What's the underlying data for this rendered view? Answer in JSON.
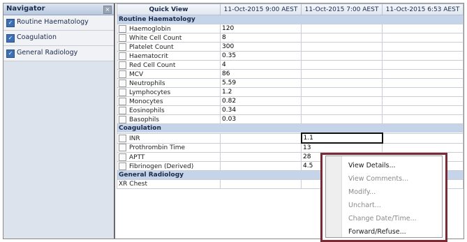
{
  "navigator": {
    "title": "Navigator",
    "close_glyph": "×",
    "items": [
      {
        "label": "Routine Haematology",
        "checked": true
      },
      {
        "label": "Coagulation",
        "checked": true
      },
      {
        "label": "General Radiology",
        "checked": true
      }
    ]
  },
  "grid": {
    "headers": [
      "Quick View",
      "11-Oct-2015 9:00 AEST",
      "11-Oct-2015 7:00 AEST",
      "11-Oct-2015 6:53 AEST"
    ],
    "sections": [
      {
        "title": "Routine Haematology",
        "rows": [
          {
            "name": "Haemoglobin",
            "checkbox": true,
            "values": [
              "120",
              "",
              ""
            ]
          },
          {
            "name": "White Cell Count",
            "checkbox": true,
            "values": [
              "8",
              "",
              ""
            ]
          },
          {
            "name": "Platelet Count",
            "checkbox": true,
            "values": [
              "300",
              "",
              ""
            ]
          },
          {
            "name": "Haematocrit",
            "checkbox": true,
            "values": [
              "0.35",
              "",
              ""
            ]
          },
          {
            "name": "Red Cell Count",
            "checkbox": true,
            "values": [
              "4",
              "",
              ""
            ]
          },
          {
            "name": "MCV",
            "checkbox": true,
            "values": [
              "86",
              "",
              ""
            ]
          },
          {
            "name": "Neutrophils",
            "checkbox": true,
            "values": [
              "5.59",
              "",
              ""
            ]
          },
          {
            "name": "Lymphocytes",
            "checkbox": true,
            "values": [
              "1.2",
              "",
              ""
            ]
          },
          {
            "name": "Monocytes",
            "checkbox": true,
            "values": [
              "0.82",
              "",
              ""
            ]
          },
          {
            "name": "Eosinophils",
            "checkbox": true,
            "values": [
              "0.34",
              "",
              ""
            ]
          },
          {
            "name": "Basophils",
            "checkbox": true,
            "values": [
              "0.03",
              "",
              ""
            ]
          }
        ]
      },
      {
        "title": "Coagulation",
        "rows": [
          {
            "name": "INR",
            "checkbox": true,
            "values": [
              "",
              "1.1",
              ""
            ]
          },
          {
            "name": "Prothrombin Time",
            "checkbox": true,
            "values": [
              "",
              "13",
              ""
            ]
          },
          {
            "name": "APTT",
            "checkbox": true,
            "values": [
              "",
              "28",
              ""
            ]
          },
          {
            "name": "Fibrinogen (Derived)",
            "checkbox": true,
            "values": [
              "",
              "4.5",
              ""
            ]
          }
        ]
      },
      {
        "title": "General Radiology",
        "rows": [
          {
            "name": "XR Chest",
            "checkbox": false,
            "values": [
              "",
              "",
              ""
            ]
          }
        ]
      }
    ]
  },
  "context_menu": {
    "items": [
      {
        "label": "View Details...",
        "enabled": true
      },
      {
        "label": "View Comments...",
        "enabled": false
      },
      {
        "label": "Modify...",
        "enabled": false
      },
      {
        "label": "Unchart...",
        "enabled": false
      },
      {
        "label": "Change Date/Time...",
        "enabled": false
      },
      {
        "label": "Forward/Refuse...",
        "enabled": true
      }
    ]
  },
  "colors": {
    "menu_highlight_border": "#7a2a32",
    "section_background": "#c5d4e8",
    "checkbox_blue": "#3d6fb4"
  }
}
